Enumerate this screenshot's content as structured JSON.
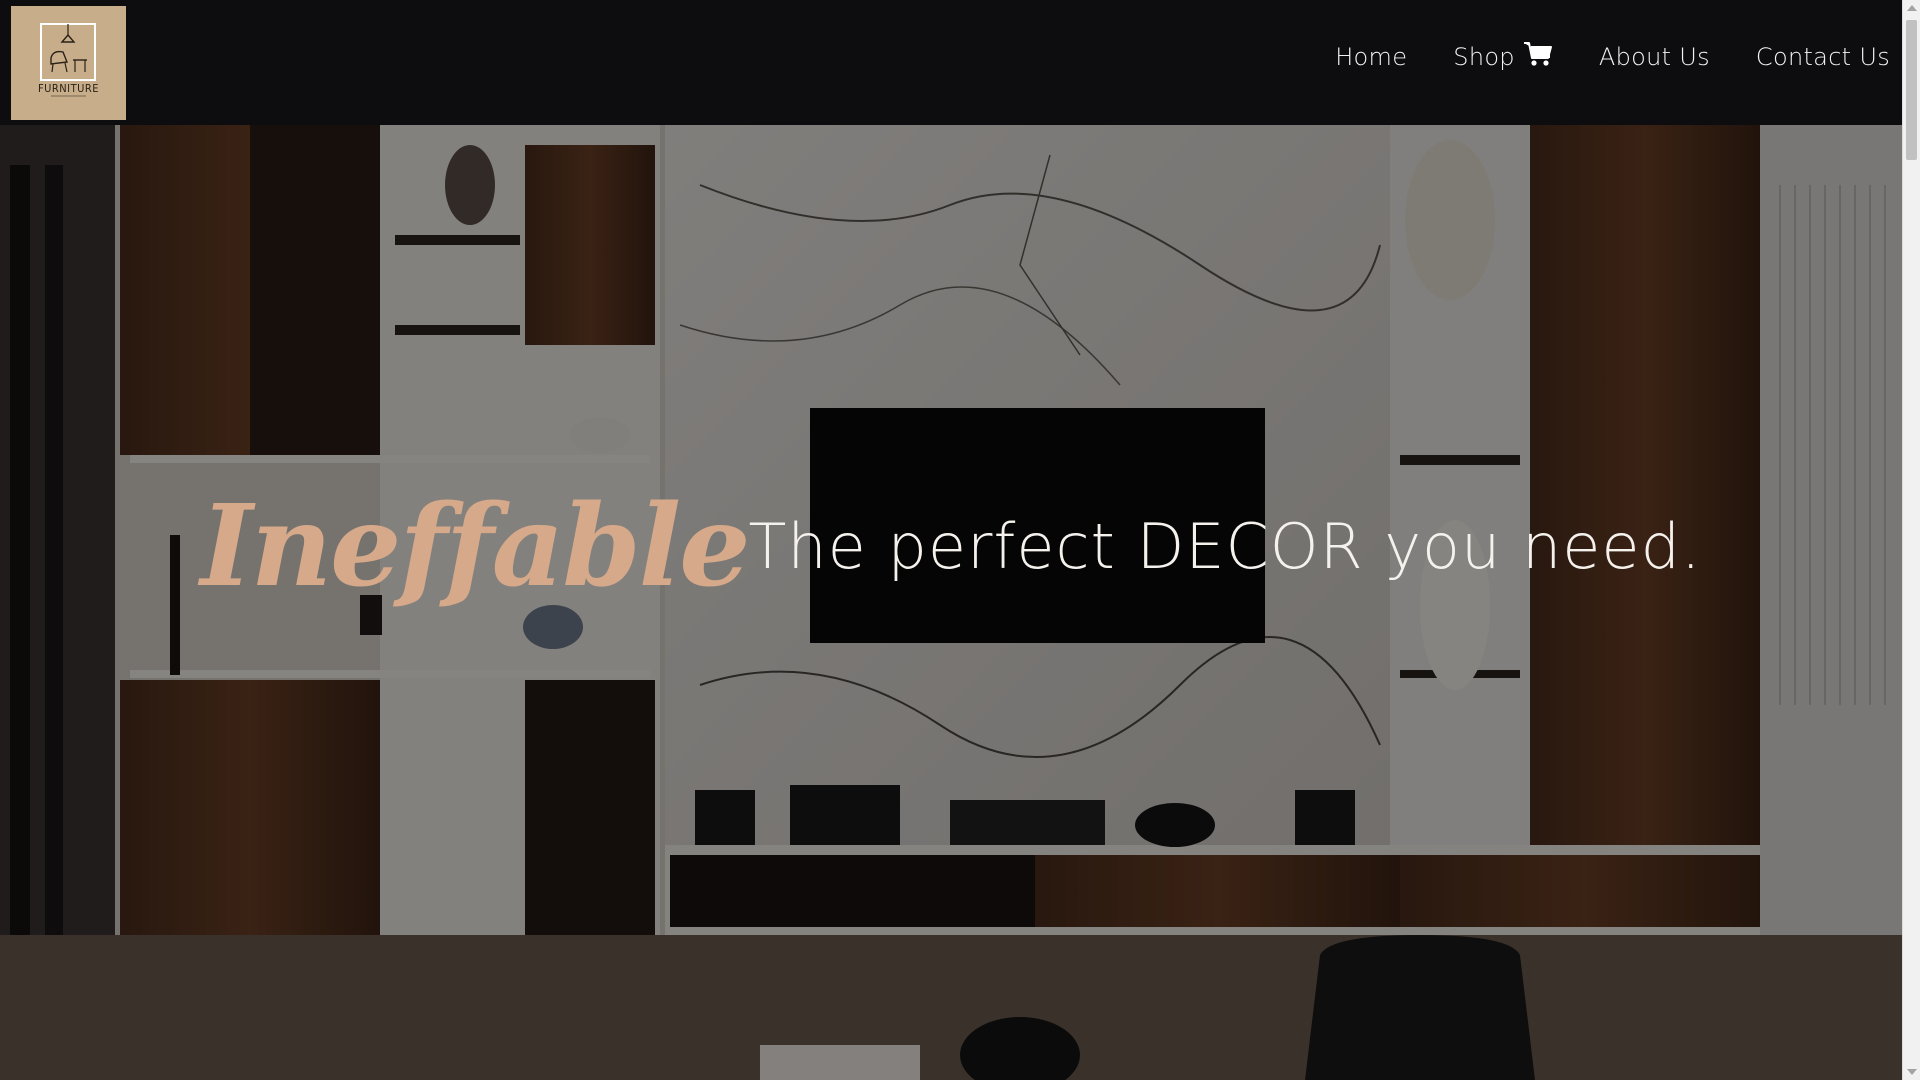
{
  "logo": {
    "text": "FURNITURE",
    "background_color": "#c8ad8a"
  },
  "nav": {
    "items": [
      {
        "label": "Home"
      },
      {
        "label": "Shop",
        "icon": "cart-icon"
      },
      {
        "label": "About Us"
      },
      {
        "label": "Contact Us"
      }
    ]
  },
  "hero": {
    "brand_script": "Ineffable",
    "tagline": "The perfect DECOR you need.",
    "script_color": "#d6a98a",
    "tagline_color": "#f5f2ee"
  },
  "colors": {
    "navbar_bg": "#0d0d0f",
    "nav_text": "#f3f3f3"
  }
}
